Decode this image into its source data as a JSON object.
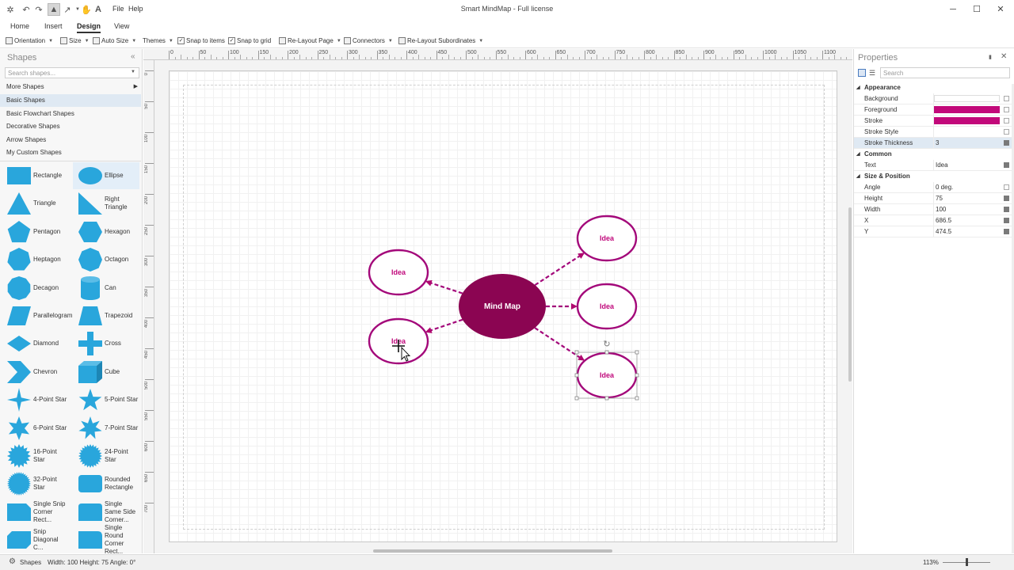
{
  "app": {
    "title": "Smart MindMap - Full license",
    "menus": [
      "File",
      "Help"
    ]
  },
  "ribbon": {
    "tabs": [
      "Home",
      "Insert",
      "Design",
      "View"
    ],
    "active_tab": "Design",
    "tools": {
      "orientation": "Orientation",
      "size": "Size",
      "auto_size": "Auto Size",
      "themes": "Themes",
      "snap_to_items": "Snap to items",
      "snap_to_grid": "Snap to grid",
      "relayout_page": "Re-Layout Page",
      "connectors": "Connectors",
      "relayout_subordinates": "Re-Layout Subordinates"
    }
  },
  "shapes_panel": {
    "title": "Shapes",
    "search_placeholder": "Search shapes...",
    "categories": [
      {
        "label": "More Shapes"
      },
      {
        "label": "Basic Shapes"
      },
      {
        "label": "Basic Flowchart Shapes"
      },
      {
        "label": "Decorative Shapes"
      },
      {
        "label": "Arrow Shapes"
      },
      {
        "label": "My Custom Shapes"
      }
    ],
    "selected_category": "Basic Shapes",
    "items": [
      {
        "label": "Rectangle",
        "icon": "rectangle-icon"
      },
      {
        "label": "Ellipse",
        "icon": "ellipse-icon"
      },
      {
        "label": "Triangle",
        "icon": "triangle-icon"
      },
      {
        "label": "Right Triangle",
        "icon": "right-triangle-icon"
      },
      {
        "label": "Pentagon",
        "icon": "pentagon-icon"
      },
      {
        "label": "Hexagon",
        "icon": "hexagon-icon"
      },
      {
        "label": "Heptagon",
        "icon": "heptagon-icon"
      },
      {
        "label": "Octagon",
        "icon": "octagon-icon"
      },
      {
        "label": "Decagon",
        "icon": "decagon-icon"
      },
      {
        "label": "Can",
        "icon": "can-icon"
      },
      {
        "label": "Parallelogram",
        "icon": "parallelogram-icon"
      },
      {
        "label": "Trapezoid",
        "icon": "trapezoid-icon"
      },
      {
        "label": "Diamond",
        "icon": "diamond-icon"
      },
      {
        "label": "Cross",
        "icon": "cross-icon"
      },
      {
        "label": "Chevron",
        "icon": "chevron-icon"
      },
      {
        "label": "Cube",
        "icon": "cube-icon"
      },
      {
        "label": "4-Point Star",
        "icon": "star4-icon"
      },
      {
        "label": "5-Point Star",
        "icon": "star5-icon"
      },
      {
        "label": "6-Point Star",
        "icon": "star6-icon"
      },
      {
        "label": "7-Point Star",
        "icon": "star7-icon"
      },
      {
        "label": "16-Point Star",
        "icon": "star16-icon"
      },
      {
        "label": "24-Point Star",
        "icon": "star24-icon"
      },
      {
        "label": "32-Point Star",
        "icon": "star32-icon"
      },
      {
        "label": "Rounded Rectangle",
        "icon": "rounded-rectangle-icon"
      },
      {
        "label": "Single Snip Corner Rect...",
        "icon": "snip-corner-icon"
      },
      {
        "label": "Single Same Side Corner...",
        "icon": "same-side-corner-icon"
      },
      {
        "label": "Snip Diagonal C...",
        "icon": "snip-diagonal-icon"
      },
      {
        "label": "Single Round Corner Rect...",
        "icon": "round-corner-icon"
      }
    ],
    "shape_color": "#29a6dc"
  },
  "canvas": {
    "ruler_top_ticks": [
      "0",
      "50",
      "100",
      "150",
      "200",
      "250",
      "300",
      "350",
      "400",
      "450",
      "500",
      "550",
      "600",
      "650",
      "700",
      "750",
      "800",
      "850",
      "900",
      "950",
      "1000",
      "1050",
      "1100"
    ],
    "ruler_left_ticks": [
      "0",
      "50",
      "100",
      "150",
      "200",
      "250",
      "300",
      "350",
      "400",
      "450",
      "500",
      "550",
      "600",
      "650",
      "700"
    ],
    "center_node": {
      "text": "Mind Map",
      "color": "#8b0552"
    },
    "child_nodes": [
      {
        "text": "Idea",
        "side": "left"
      },
      {
        "text": "Idea",
        "side": "left"
      },
      {
        "text": "Idea",
        "side": "right"
      },
      {
        "text": "Idea",
        "side": "right"
      },
      {
        "text": "Idea",
        "side": "right",
        "selected": true
      }
    ],
    "node_stroke": "#a3087a",
    "node_text_color": "#c0087b"
  },
  "properties_panel": {
    "title": "Properties",
    "search_placeholder": "Search",
    "groups": [
      {
        "name": "Appearance",
        "rows": [
          {
            "name": "Background",
            "value": "",
            "swatch": ""
          },
          {
            "name": "Foreground",
            "value": "",
            "swatch": "#c2097a"
          },
          {
            "name": "Stroke",
            "value": "",
            "swatch": "#c2097a"
          },
          {
            "name": "Stroke Style",
            "value": "",
            "swatch": ""
          },
          {
            "name": "Stroke Thickness",
            "value": "3",
            "swatch": "",
            "selected": true,
            "set": true
          }
        ]
      },
      {
        "name": "Common",
        "rows": [
          {
            "name": "Text",
            "value": "Idea",
            "swatch": "",
            "set": true
          }
        ]
      },
      {
        "name": "Size & Position",
        "rows": [
          {
            "name": "Angle",
            "value": "0 deg.",
            "swatch": ""
          },
          {
            "name": "Height",
            "value": "75",
            "swatch": "",
            "set": true
          },
          {
            "name": "Width",
            "value": "100",
            "swatch": "",
            "set": true
          },
          {
            "name": "X",
            "value": "686.5",
            "swatch": "",
            "set": true
          },
          {
            "name": "Y",
            "value": "474.5",
            "swatch": "",
            "set": true
          }
        ]
      }
    ]
  },
  "statusbar": {
    "shapes_label": "Shapes",
    "info": "Width: 100  Height: 75  Angle: 0°",
    "zoom": "113%"
  }
}
